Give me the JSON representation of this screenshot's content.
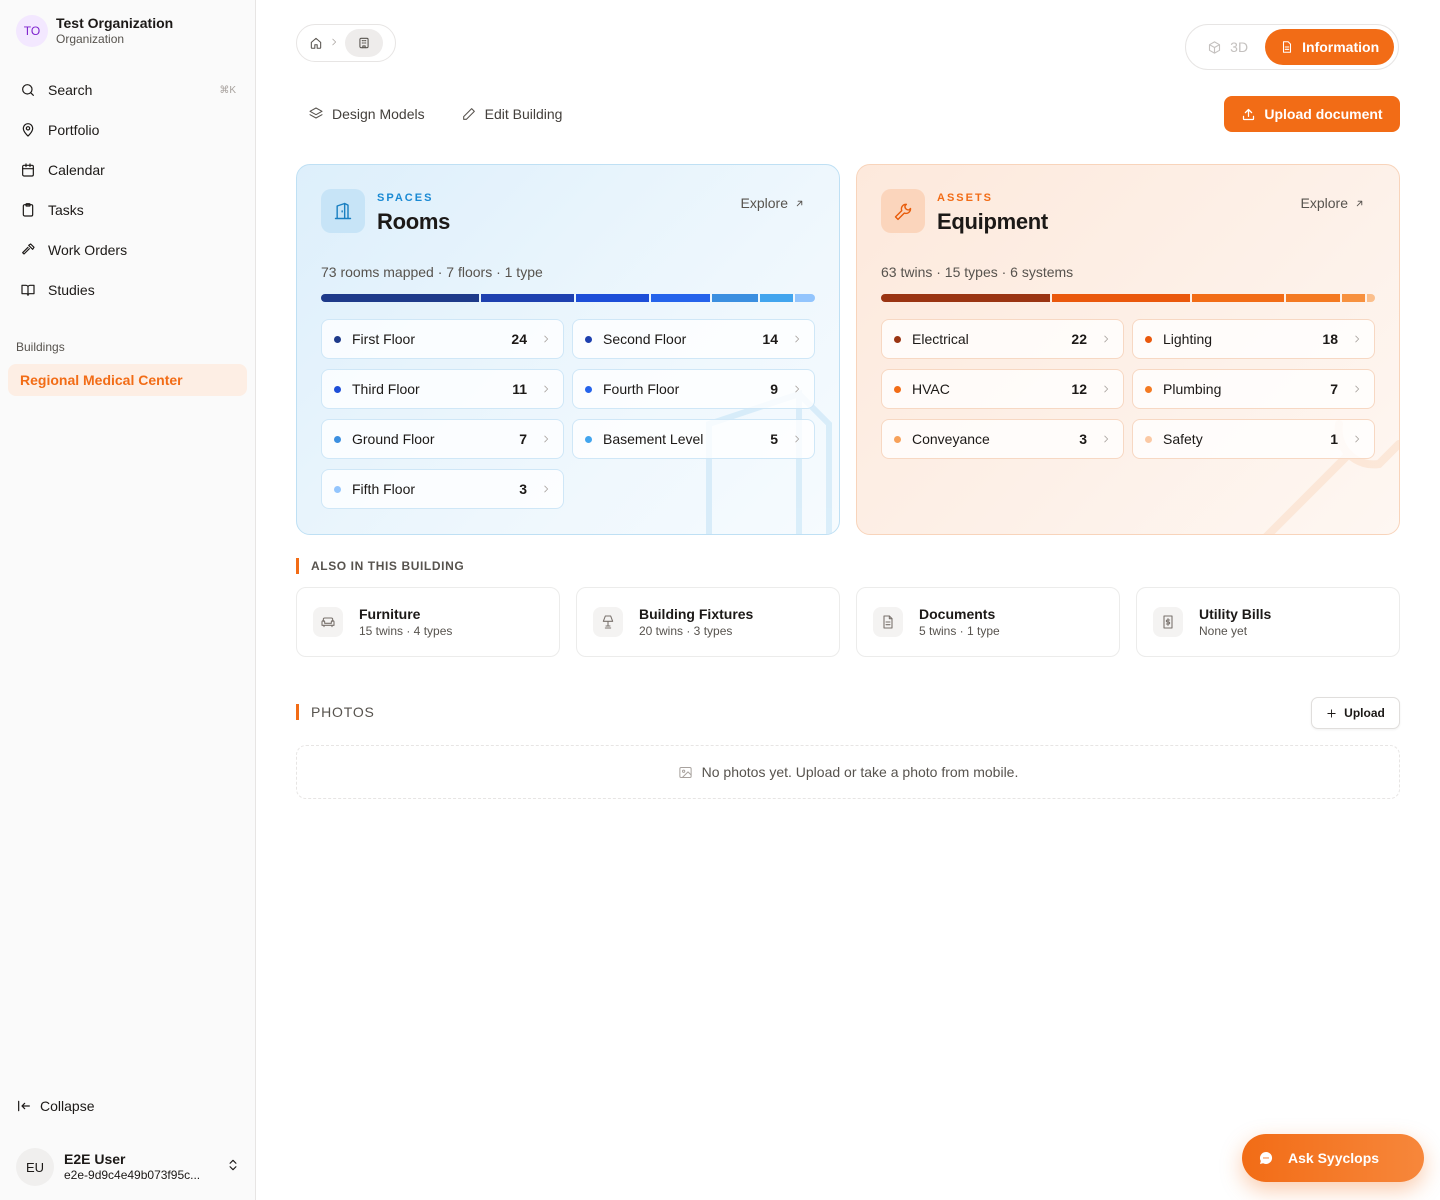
{
  "org": {
    "initials": "TO",
    "name": "Test Organization",
    "type": "Organization"
  },
  "nav": {
    "search": {
      "label": "Search",
      "shortcut": "⌘K",
      "icon": "search-icon"
    },
    "portfolio": {
      "label": "Portfolio",
      "icon": "map-pin-icon"
    },
    "calendar": {
      "label": "Calendar",
      "icon": "calendar-icon"
    },
    "tasks": {
      "label": "Tasks",
      "icon": "clipboard-icon"
    },
    "work_orders": {
      "label": "Work Orders",
      "icon": "hammer-icon"
    },
    "studies": {
      "label": "Studies",
      "icon": "book-icon"
    }
  },
  "buildings": {
    "section_label": "Buildings",
    "items": [
      "Regional Medical Center"
    ]
  },
  "sidebar_footer": {
    "collapse_label": "Collapse"
  },
  "user": {
    "initials": "EU",
    "name": "E2E User",
    "id": "e2e-9d9c4e49b073f95c..."
  },
  "view_toggle": {
    "three_d": "3D",
    "information": "Information",
    "active": "Information"
  },
  "toolbar": {
    "design_models": "Design Models",
    "edit_building": "Edit Building",
    "upload_document": "Upload document"
  },
  "spaces": {
    "eyebrow": "SPACES",
    "title": "Rooms",
    "explore": "Explore",
    "meta": "73 rooms mapped · 7 floors · 1 type",
    "bar_colors": [
      "#1e3a8a",
      "#1e40af",
      "#1d4ed8",
      "#2563eb",
      "#3b8fe0",
      "#42a5ee",
      "#93c5fd"
    ],
    "bar_values": [
      24,
      14,
      11,
      9,
      7,
      5,
      3
    ],
    "items": [
      {
        "label": "First Floor",
        "count": "24",
        "color": "#1e3a8a"
      },
      {
        "label": "Second Floor",
        "count": "14",
        "color": "#1e40af"
      },
      {
        "label": "Third Floor",
        "count": "11",
        "color": "#1d4ed8"
      },
      {
        "label": "Fourth Floor",
        "count": "9",
        "color": "#2563eb"
      },
      {
        "label": "Ground Floor",
        "count": "7",
        "color": "#3b8fe0"
      },
      {
        "label": "Basement Level",
        "count": "5",
        "color": "#42a5ee"
      },
      {
        "label": "Fifth Floor",
        "count": "3",
        "color": "#93c5fd"
      }
    ]
  },
  "assets": {
    "eyebrow": "ASSETS",
    "title": "Equipment",
    "explore": "Explore",
    "meta": "63 twins · 15 types · 6 systems",
    "bar_colors": [
      "#9a3412",
      "#ea580c",
      "#f26c16",
      "#f47a22",
      "#f7913f",
      "#fbbf8c"
    ],
    "bar_values": [
      22,
      18,
      12,
      7,
      3,
      1
    ],
    "items": [
      {
        "label": "Electrical",
        "count": "22",
        "color": "#9a3412"
      },
      {
        "label": "Lighting",
        "count": "18",
        "color": "#ea580c"
      },
      {
        "label": "HVAC",
        "count": "12",
        "color": "#f26c16"
      },
      {
        "label": "Plumbing",
        "count": "7",
        "color": "#f47a22"
      },
      {
        "label": "Conveyance",
        "count": "3",
        "color": "#f7a15a"
      },
      {
        "label": "Safety",
        "count": "1",
        "color": "#fbc9a4"
      }
    ]
  },
  "also": {
    "heading": "ALSO IN THIS BUILDING",
    "items": [
      {
        "title": "Furniture",
        "sub": "15 twins · 4 types",
        "icon": "sofa-icon"
      },
      {
        "title": "Building Fixtures",
        "sub": "20 twins · 3 types",
        "icon": "lamp-icon"
      },
      {
        "title": "Documents",
        "sub": "5 twins · 1 type",
        "icon": "document-icon"
      },
      {
        "title": "Utility Bills",
        "sub": "None yet",
        "icon": "receipt-icon"
      }
    ]
  },
  "photos": {
    "heading": "PHOTOS",
    "upload": "Upload",
    "empty": "No photos yet. Upload or take a photo from mobile."
  },
  "ask": {
    "label": "Ask Syyclops"
  },
  "colors": {
    "accent": "#f26c16",
    "spaces_accent": "#1a8ad4"
  }
}
